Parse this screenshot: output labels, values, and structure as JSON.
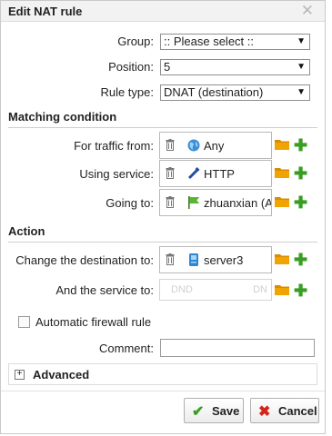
{
  "dialog": {
    "title": "Edit NAT rule"
  },
  "form": {
    "group_label": "Group:",
    "group_value": ":: Please select ::",
    "position_label": "Position:",
    "position_value": "5",
    "rule_type_label": "Rule type:",
    "rule_type_value": "DNAT (destination)"
  },
  "matching": {
    "header": "Matching condition",
    "traffic_from_label": "For traffic from:",
    "traffic_from_value": "Any",
    "using_service_label": "Using service:",
    "using_service_value": "HTTP",
    "going_to_label": "Going to:",
    "going_to_value": "zhuanxian (Ac"
  },
  "action": {
    "header": "Action",
    "change_dest_label": "Change the destination to:",
    "change_dest_value": "server3",
    "service_label": "And the service to:",
    "service_placeholder_left": "DND",
    "service_placeholder_right": "DN"
  },
  "automatic_rule_label": "Automatic firewall rule",
  "comment_label": "Comment:",
  "advanced_label": "Advanced",
  "buttons": {
    "save": "Save",
    "cancel": "Cancel"
  },
  "colors": {
    "plus": "#3a9d23",
    "folder": "#f0a400",
    "cancel_icon": "#d3261b",
    "save_icon": "#3a9d23"
  }
}
